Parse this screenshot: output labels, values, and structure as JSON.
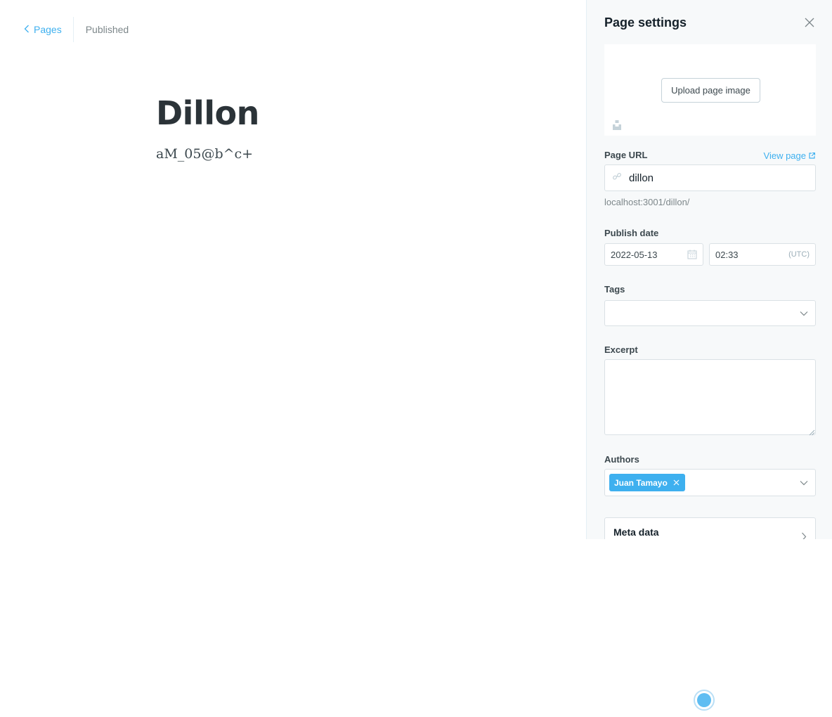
{
  "topbar": {
    "back_label": "Pages",
    "status": "Published"
  },
  "editor": {
    "title": "Dillon",
    "body": "aM_05@b^c+"
  },
  "settings": {
    "title": "Page settings",
    "upload_label": "Upload page image",
    "url_label": "Page URL",
    "view_page_label": "View page",
    "slug": "dillon",
    "url_hint": "localhost:3001/dillon/",
    "publish_date_label": "Publish date",
    "date": "2022-05-13",
    "time": "02:33",
    "timezone": "(UTC)",
    "tags_label": "Tags",
    "excerpt_label": "Excerpt",
    "excerpt_value": "",
    "authors_label": "Authors",
    "authors": [
      "Juan Tamayo"
    ],
    "meta_label": "Meta data"
  },
  "colors": {
    "accent": "#3eb0ef",
    "panel_bg": "#f7f9fa",
    "border": "#dae1e5"
  },
  "icons": [
    "chevron-left-icon",
    "close-icon",
    "unsplash-icon",
    "external-link-icon",
    "link-icon",
    "calendar-icon",
    "chevron-down-icon",
    "chevron-right-icon"
  ]
}
